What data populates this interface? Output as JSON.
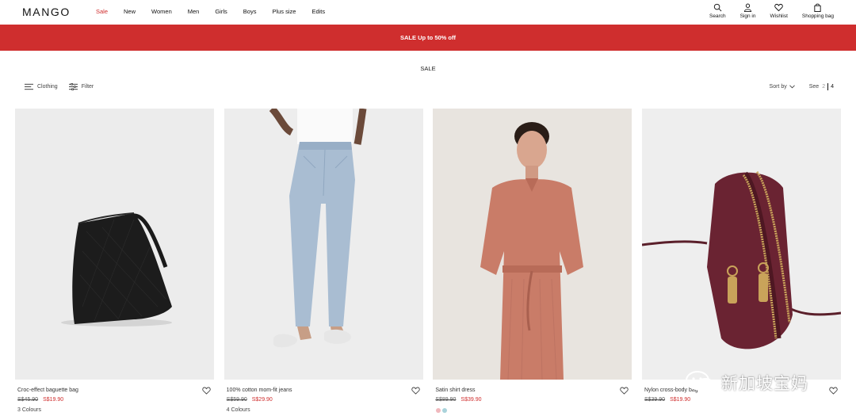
{
  "header": {
    "logo": "MANGO",
    "nav": [
      "Sale",
      "New",
      "Women",
      "Men",
      "Girls",
      "Boys",
      "Plus size",
      "Edits"
    ],
    "utils": [
      {
        "label": "Search",
        "icon": "search-icon"
      },
      {
        "label": "Sign in",
        "icon": "user-icon"
      },
      {
        "label": "Wishlist",
        "icon": "heart-icon"
      },
      {
        "label": "Shopping bag",
        "icon": "bag-icon"
      }
    ]
  },
  "promo": {
    "text": "SALE Up to 50% off",
    "color": "#cf2e2e"
  },
  "page": {
    "title": "SALE"
  },
  "toolbar": {
    "clothing": "Clothing",
    "filter": "Filter",
    "sort": "Sort by",
    "see": "See",
    "see_options": [
      "2",
      "4"
    ],
    "see_selected": "4"
  },
  "products": [
    {
      "name": "Croc-effect baguette bag",
      "old_price": "S$45.90",
      "new_price": "S$19.90",
      "colors": "3 Colours"
    },
    {
      "name": "100% cotton mom-fit jeans",
      "old_price": "S$59.90",
      "new_price": "S$29.90",
      "colors": "4 Colours"
    },
    {
      "name": "Satin shirt dress",
      "old_price": "S$89.90",
      "new_price": "S$39.90",
      "colors": ""
    },
    {
      "name": "Nylon cross-body bag",
      "old_price": "S$39.90",
      "new_price": "S$19.90",
      "colors": ""
    }
  ],
  "watermark": {
    "text": "新加坡宝妈"
  },
  "colors": {
    "sale_red": "#cf2c2c",
    "swatch_pink": "#f0b8bd",
    "swatch_blue": "#a9d3db"
  }
}
